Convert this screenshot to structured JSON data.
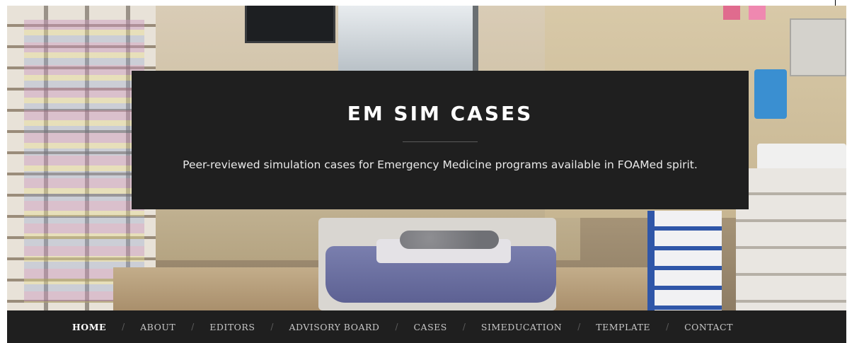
{
  "site": {
    "title": "EM SIM CASES",
    "tagline": "Peer-reviewed simulation cases for Emergency Medicine programs available in FOAMed spirit."
  },
  "nav": {
    "separator": "/",
    "items": [
      {
        "label": "HOME",
        "active": true
      },
      {
        "label": "ABOUT",
        "active": false
      },
      {
        "label": "EDITORS",
        "active": false
      },
      {
        "label": "ADVISORY BOARD",
        "active": false
      },
      {
        "label": "CASES",
        "active": false
      },
      {
        "label": "SIMEDUCATION",
        "active": false
      },
      {
        "label": "TEMPLATE",
        "active": false
      },
      {
        "label": "CONTACT",
        "active": false
      }
    ]
  },
  "colors": {
    "card_background": "#1f1f1f",
    "nav_background": "#1f1f1f",
    "title_text": "#ffffff",
    "nav_text": "#c7c7c7",
    "nav_active_text": "#ffffff"
  }
}
